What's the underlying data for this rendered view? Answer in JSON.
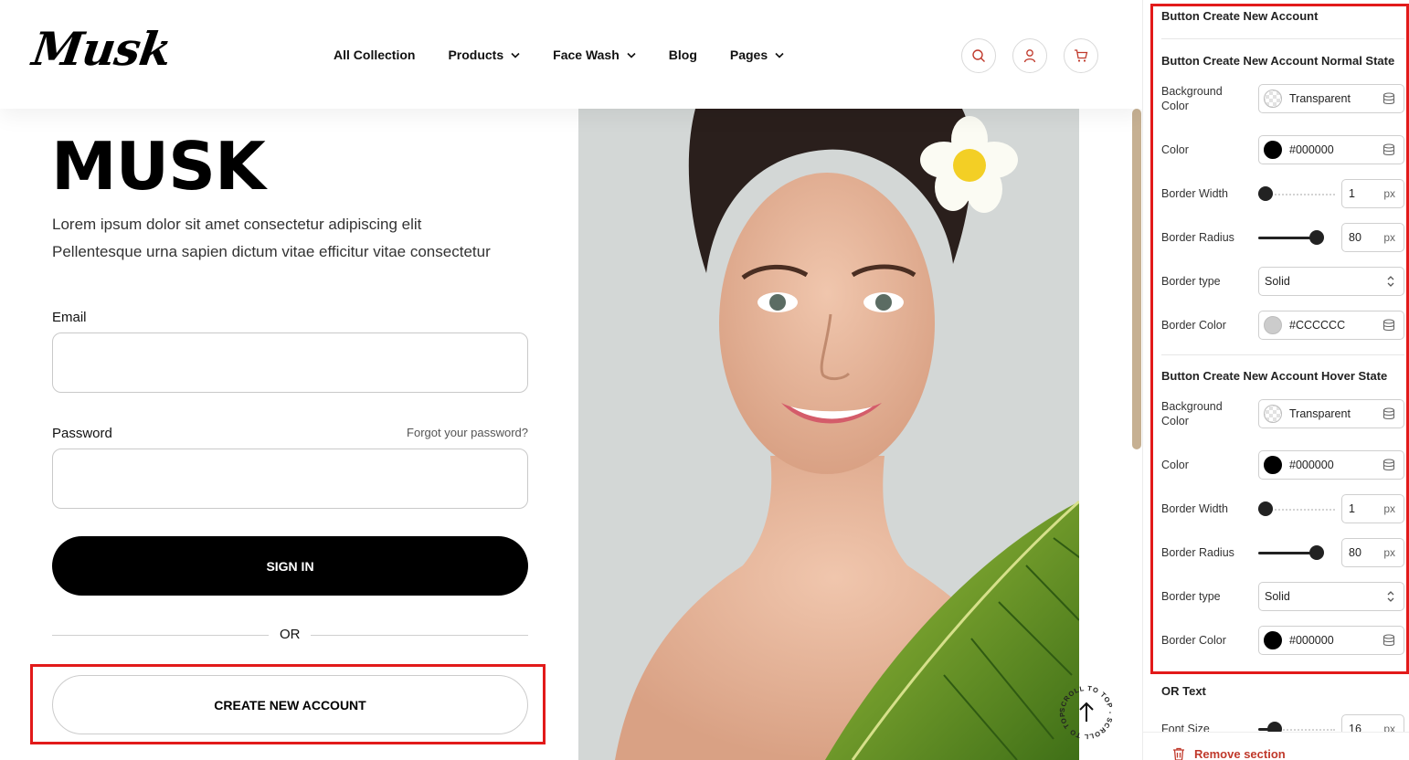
{
  "header": {
    "logo": "Musk",
    "nav": [
      {
        "label": "All Collection",
        "has_dropdown": false
      },
      {
        "label": "Products",
        "has_dropdown": true
      },
      {
        "label": "Face Wash",
        "has_dropdown": true
      },
      {
        "label": "Blog",
        "has_dropdown": false
      },
      {
        "label": "Pages",
        "has_dropdown": true
      }
    ],
    "icons": [
      "search-icon",
      "user-icon",
      "cart-icon"
    ],
    "icon_color": "#c0392b"
  },
  "login": {
    "title": "MUSK",
    "description_line1": "Lorem ipsum dolor sit amet consectetur adipiscing elit",
    "description_line2": "Pellentesque urna sapien dictum vitae efficitur vitae consectetur",
    "email_label": "Email",
    "email_value": "",
    "password_label": "Password",
    "password_value": "",
    "forgot_label": "Forgot your password?",
    "sign_in_label": "SIGN IN",
    "or_label": "OR",
    "create_label": "CREATE NEW ACCOUNT"
  },
  "scroll_to_top": {
    "label": "SCROLL TO TOP - SCROLL TO TOP -"
  },
  "panel": {
    "section_title": "Button Create New Account",
    "normal_title": "Button Create New Account Normal State",
    "hover_title": "Button Create New Account Hover State",
    "labels": {
      "background_color": "Background Color",
      "color": "Color",
      "border_width": "Border Width",
      "border_radius": "Border Radius",
      "border_type": "Border type",
      "border_color": "Border Color"
    },
    "normal": {
      "background_color": "Transparent",
      "color": "#000000",
      "border_width": "1",
      "border_radius": "80",
      "border_type": "Solid",
      "border_color": "#CCCCCC"
    },
    "hover": {
      "background_color": "Transparent",
      "color": "#000000",
      "border_width": "1",
      "border_radius": "80",
      "border_type": "Solid",
      "border_color": "#000000"
    },
    "unit": "px",
    "or_text_title": "OR Text",
    "font_size_label": "Font Size",
    "font_size_value": "16",
    "remove_label": "Remove section"
  },
  "colors": {
    "highlight": "#e21a1a",
    "scroll_thumb": "#c6b092",
    "remove": "#c0392b"
  }
}
